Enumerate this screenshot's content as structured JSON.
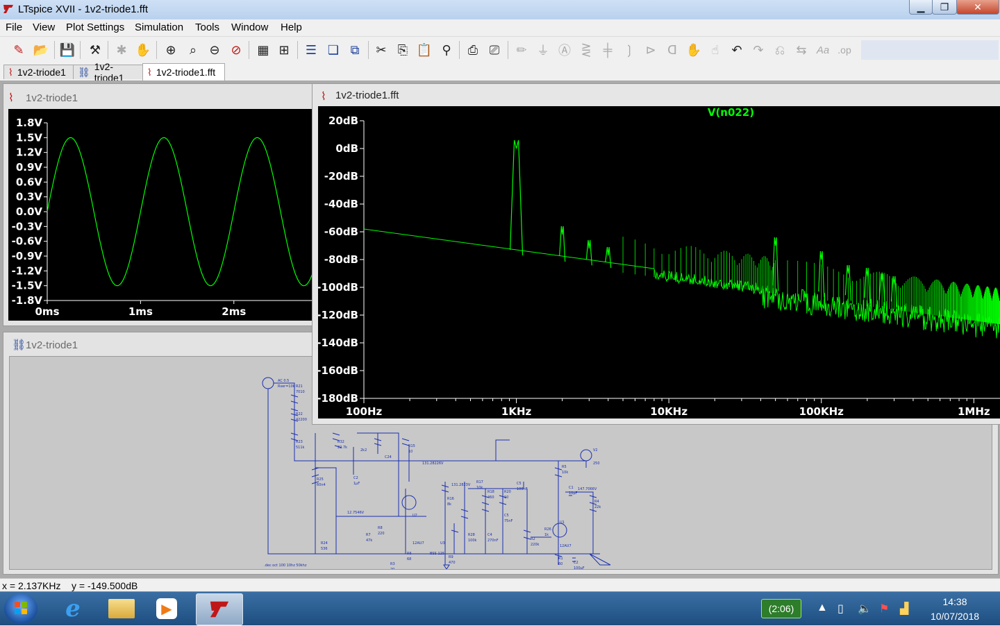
{
  "window": {
    "title": "LTspice XVII - 1v2-triode1.fft"
  },
  "menu": [
    "File",
    "View",
    "Plot Settings",
    "Simulation",
    "Tools",
    "Window",
    "Help"
  ],
  "tabs": [
    {
      "label": "1v2-triode1",
      "icon": "waveform-icon"
    },
    {
      "label": "1v2-triode1",
      "icon": "schematic-icon"
    },
    {
      "label": "1v2-triode1.fft",
      "icon": "waveform-icon",
      "active": true
    }
  ],
  "left_plot": {
    "title": "1v2-triode1",
    "chart_data": {
      "type": "line",
      "y_ticks": [
        "1.8V",
        "1.5V",
        "1.2V",
        "0.9V",
        "0.6V",
        "0.3V",
        "0.0V",
        "-0.3V",
        "-0.6V",
        "-0.9V",
        "-1.2V",
        "-1.5V",
        "-1.8V"
      ],
      "x_ticks": [
        "0ms",
        "1ms",
        "2ms"
      ],
      "ylim": [
        -1.8,
        1.8
      ],
      "xlim_ms": [
        0,
        2.85
      ],
      "amplitude_v": 1.5,
      "frequency_khz": 1,
      "color": "#00ff00"
    }
  },
  "schematic": {
    "title": "1v2-triode1",
    "footer_note": ".dec oct 100 10hz 50khz"
  },
  "fft_plot": {
    "title": "1v2-triode1.fft",
    "chart_data": {
      "type": "line",
      "trace_label": "V(n022)",
      "color": "#00ff00",
      "y_ticks": [
        "20dB",
        "0dB",
        "-20dB",
        "-40dB",
        "-60dB",
        "-80dB",
        "-100dB",
        "-120dB",
        "-140dB",
        "-160dB",
        "-180dB"
      ],
      "ylim": [
        -180,
        20
      ],
      "x_ticks": [
        "100Hz",
        "1KHz",
        "10KHz",
        "100KHz",
        "1MHz"
      ],
      "x_scale": "log",
      "xlim_hz": [
        100,
        1500000
      ],
      "noise_floor_db": {
        "at_100hz": -58,
        "at_1mhz": -118
      },
      "peaks": [
        {
          "freq_hz": 1000,
          "db": 0
        },
        {
          "freq_hz": 2000,
          "db": -62
        },
        {
          "freq_hz": 3000,
          "db": -72
        },
        {
          "freq_hz": 4000,
          "db": -77
        },
        {
          "freq_hz": 50000,
          "db": -70
        },
        {
          "freq_hz": 100000,
          "db": -80
        },
        {
          "freq_hz": 150000,
          "db": -90
        },
        {
          "freq_hz": 200000,
          "db": -92
        },
        {
          "freq_hz": 250000,
          "db": -96
        },
        {
          "freq_hz": 300000,
          "db": -98
        }
      ]
    }
  },
  "status": {
    "text": "x = 2.137KHz    y = -149.500dB"
  },
  "taskbar": {
    "battery_label": "(2:06)",
    "time": "14:38",
    "date": "10/07/2018"
  }
}
